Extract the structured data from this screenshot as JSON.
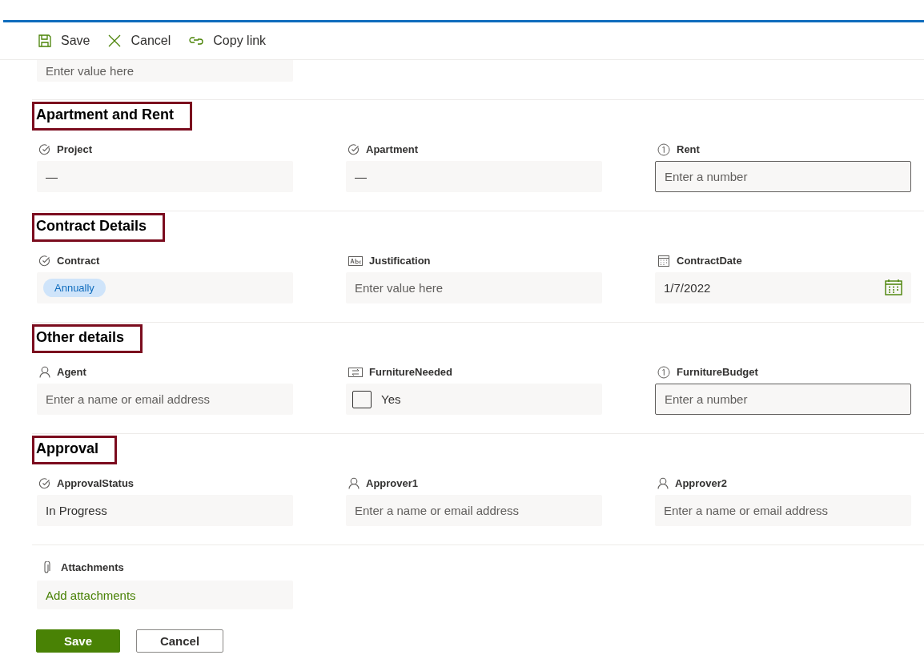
{
  "toolbar": [
    {
      "kind": "save",
      "label": "Save"
    },
    {
      "kind": "cancel",
      "label": "Cancel"
    },
    {
      "kind": "link",
      "label": "Copy link"
    }
  ],
  "top_field": {
    "placeholder": "Enter value here"
  },
  "sections": [
    {
      "heading": "Apartment and Rent",
      "fields": [
        {
          "kind": "choice",
          "label": "Project",
          "value": "—"
        },
        {
          "kind": "choice",
          "label": "Apartment",
          "value": "—"
        },
        {
          "kind": "number",
          "label": "Rent",
          "placeholder": "Enter a number"
        }
      ]
    },
    {
      "heading": "Contract Details",
      "fields": [
        {
          "kind": "choice",
          "label": "Contract",
          "tag": "Annually"
        },
        {
          "kind": "text",
          "label": "Justification",
          "placeholder": "Enter value here"
        },
        {
          "kind": "date",
          "label": "ContractDate",
          "value": "1/7/2022"
        }
      ]
    },
    {
      "heading": "Other details",
      "fields": [
        {
          "kind": "person",
          "label": "Agent",
          "placeholder": "Enter a name or email address"
        },
        {
          "kind": "yesno",
          "label": "FurnitureNeeded",
          "option_label": "Yes",
          "checked": false
        },
        {
          "kind": "number",
          "label": "FurnitureBudget",
          "placeholder": "Enter a number"
        }
      ]
    },
    {
      "heading": "Approval",
      "fields": [
        {
          "kind": "choice",
          "label": "ApprovalStatus",
          "value": "In Progress"
        },
        {
          "kind": "person",
          "label": "Approver1",
          "placeholder": "Enter a name or email address"
        },
        {
          "kind": "person",
          "label": "Approver2",
          "placeholder": "Enter a name or email address"
        }
      ]
    }
  ],
  "attachments": {
    "label": "Attachments",
    "action": "Add attachments"
  },
  "buttons": [
    {
      "kind": "primary",
      "label": "Save"
    },
    {
      "kind": "secondary",
      "label": "Cancel"
    }
  ]
}
